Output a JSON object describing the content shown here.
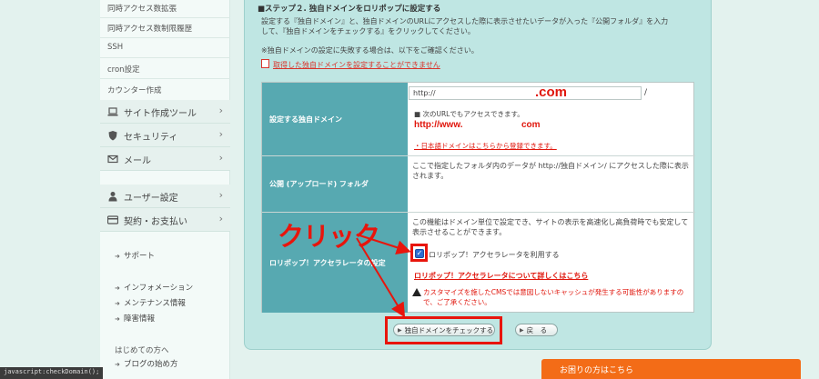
{
  "sidebar": {
    "sub_items": [
      "同時アクセス数拡張",
      "同時アクセス数制限履歴",
      "SSH",
      "cron設定",
      "カウンター作成"
    ],
    "nav_items": [
      {
        "label": "サイト作成ツール",
        "icon": "laptop-icon"
      },
      {
        "label": "セキュリティ",
        "icon": "shield-icon"
      },
      {
        "label": "メール",
        "icon": "mail-icon"
      },
      {
        "label": "ユーザー設定",
        "icon": "user-icon"
      },
      {
        "label": "契約・お支払い",
        "icon": "credit-card-icon"
      }
    ],
    "support": "サポート",
    "info_links": [
      "インフォメーション",
      "メンテナンス情報",
      "障害情報"
    ],
    "beginner_heading": "はじめての方へ",
    "blog_start": "ブログの始め方"
  },
  "status_bar": "javascript:checkDomain();",
  "step": {
    "title": "■ステップ２. 独自ドメインをロリポップに設定する",
    "desc_line1": "設定する『独自ドメイン』と、独自ドメインのURLにアクセスした際に表示させたいデータが入った『公開フォルダ』を入力",
    "desc_line2": "して、『独自ドメインをチェックする』をクリックしてください。",
    "fail_note": "※独自ドメインの設定に失敗する場合は、以下をご確認ください。",
    "help_link": "取得した独自ドメインを設定することができません"
  },
  "table": {
    "domain_label": "設定する独自ドメイン",
    "domain_prefix": "http://",
    "domain_value": ".com",
    "domain_suffix": "/",
    "access_note": "■ 次のURLでもアクセスできます。",
    "url_prefix": "http://www.",
    "url_suffix": "com",
    "jp_domain_link": "・日本語ドメインはこちらから登録できます。",
    "folder_label": "公開 (アップロード) フォルダ",
    "folder_desc": "ここで指定したフォルダ内のデータが http://独自ドメイン/ にアクセスした際に表示されます。",
    "accel_label": "ロリポップ！アクセラレータの設定",
    "accel_desc": "この機能はドメイン単位で設定でき、サイトの表示を高速化し高負荷時でも安定して表示させることができます。",
    "accel_checkbox": "ロリポップ！アクセラレータを利用する",
    "accel_checked": true,
    "accel_detail_link": "ロリポップ！アクセラレータについて詳しくはこちら",
    "warning": "カスタマイズを施したCMSでは意図しないキャッシュが発生する可能性がありますので、ご了承ください。"
  },
  "annotation": {
    "click_label": "クリック",
    "color": "#e8150c"
  },
  "buttons": {
    "check_domain": "独自ドメインをチェックする",
    "back": "戻　る"
  },
  "help_banner": "お困りの方はこちら",
  "colors": {
    "accent_teal": "#57a9b1",
    "panel_bg": "#bfe6e3",
    "highlight_red": "#e0160c",
    "banner_orange": "#f36c17"
  }
}
